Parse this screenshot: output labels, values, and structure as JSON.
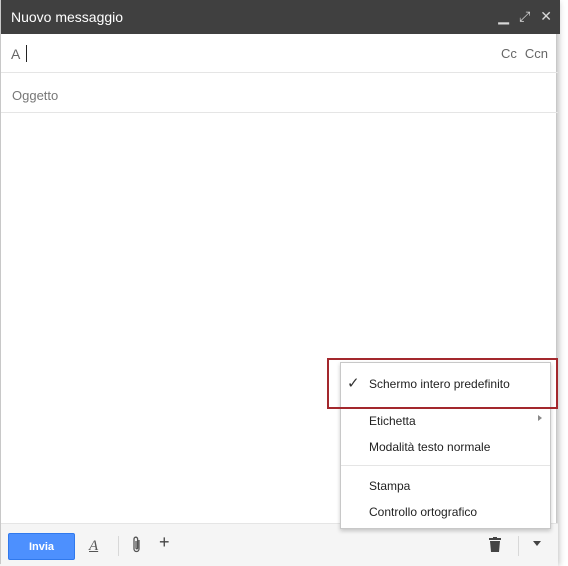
{
  "window": {
    "title": "Nuovo messaggio"
  },
  "titlebar": {
    "icons": [
      "minimize-icon",
      "expand-icon",
      "close-icon"
    ]
  },
  "to_row": {
    "label": "A",
    "value": "",
    "cc": "Cc",
    "bcc": "Ccn"
  },
  "subject": {
    "placeholder": "Oggetto",
    "value": ""
  },
  "toolbar": {
    "send_label": "Invia"
  },
  "menu": {
    "items": [
      {
        "label": "Schermo intero predefinito",
        "checked": true
      },
      {
        "label": "Etichetta",
        "submenu": true
      },
      {
        "label": "Modalità testo normale"
      },
      {
        "label": "Stampa"
      },
      {
        "label": "Controllo ortografico"
      }
    ]
  },
  "colors": {
    "titlebar": "#404040",
    "send_button": "#4d90fe",
    "highlight": "#a3282d"
  }
}
